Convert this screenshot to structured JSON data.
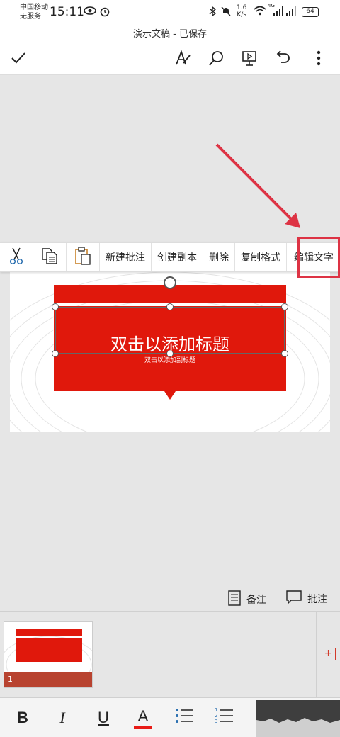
{
  "status_bar": {
    "carrier_line1": "中国移动",
    "carrier_line2": "无服务",
    "time": "15:11",
    "net_speed_value": "1.6",
    "net_speed_unit": "K/s",
    "network_type": "4G",
    "battery": "64"
  },
  "title_bar": {
    "title": "演示文稿 - 已保存"
  },
  "icons": {
    "done": "checkmark-icon",
    "draw": "pen-draw-icon",
    "search": "search-icon",
    "present": "present-icon",
    "undo": "undo-icon",
    "more": "more-vertical-icon"
  },
  "context_menu": {
    "items": [
      "新建批注",
      "创建副本",
      "删除",
      "复制格式",
      "编辑文字"
    ]
  },
  "slide": {
    "title_placeholder": "双击以添加标题",
    "subtitle_placeholder": "双击以添加副标题"
  },
  "bottom_actions": {
    "notes": "备注",
    "comments": "批注"
  },
  "thumbnails": [
    {
      "number": "1"
    }
  ],
  "format_toolbar": {
    "bold": "B",
    "italic": "I",
    "underline": "U",
    "font_color": "A"
  },
  "colors": {
    "accent_red": "#e0180c",
    "annotation_red": "#dd3344",
    "thumb_bar": "#b84330"
  }
}
